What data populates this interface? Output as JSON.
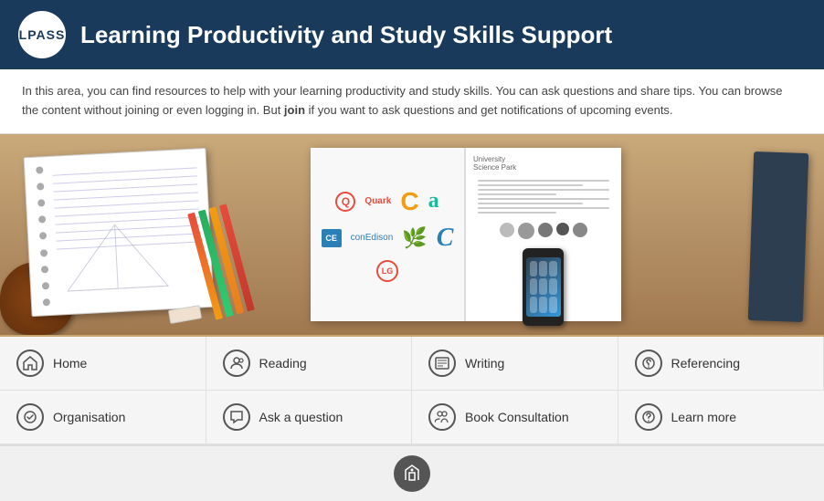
{
  "header": {
    "logo": "LPASS",
    "title": "Learning Productivity and Study Skills Support"
  },
  "description": {
    "text": "In this area, you can find resources to help with your learning productivity and study skills. You can ask questions and share tips. You can browse the content without joining or even logging in. But",
    "join_word": "join",
    "text2": "if you want to ask questions and get notifications of upcoming events."
  },
  "nav": {
    "items": [
      {
        "id": "home",
        "label": "Home",
        "icon": "🏠",
        "row": 1
      },
      {
        "id": "reading",
        "label": "Reading",
        "icon": "👤",
        "row": 1
      },
      {
        "id": "writing",
        "label": "Writing",
        "icon": "⌨",
        "row": 1
      },
      {
        "id": "referencing",
        "label": "Referencing",
        "icon": "🔧",
        "row": 1
      },
      {
        "id": "organisation",
        "label": "Organisation",
        "icon": "📋",
        "row": 2
      },
      {
        "id": "ask-question",
        "label": "Ask a question",
        "icon": "💬",
        "row": 2
      },
      {
        "id": "book-consultation",
        "label": "Book Consultation",
        "icon": "👥",
        "row": 2
      },
      {
        "id": "learn-more",
        "label": "Learn more",
        "icon": "❓",
        "row": 2
      }
    ]
  }
}
